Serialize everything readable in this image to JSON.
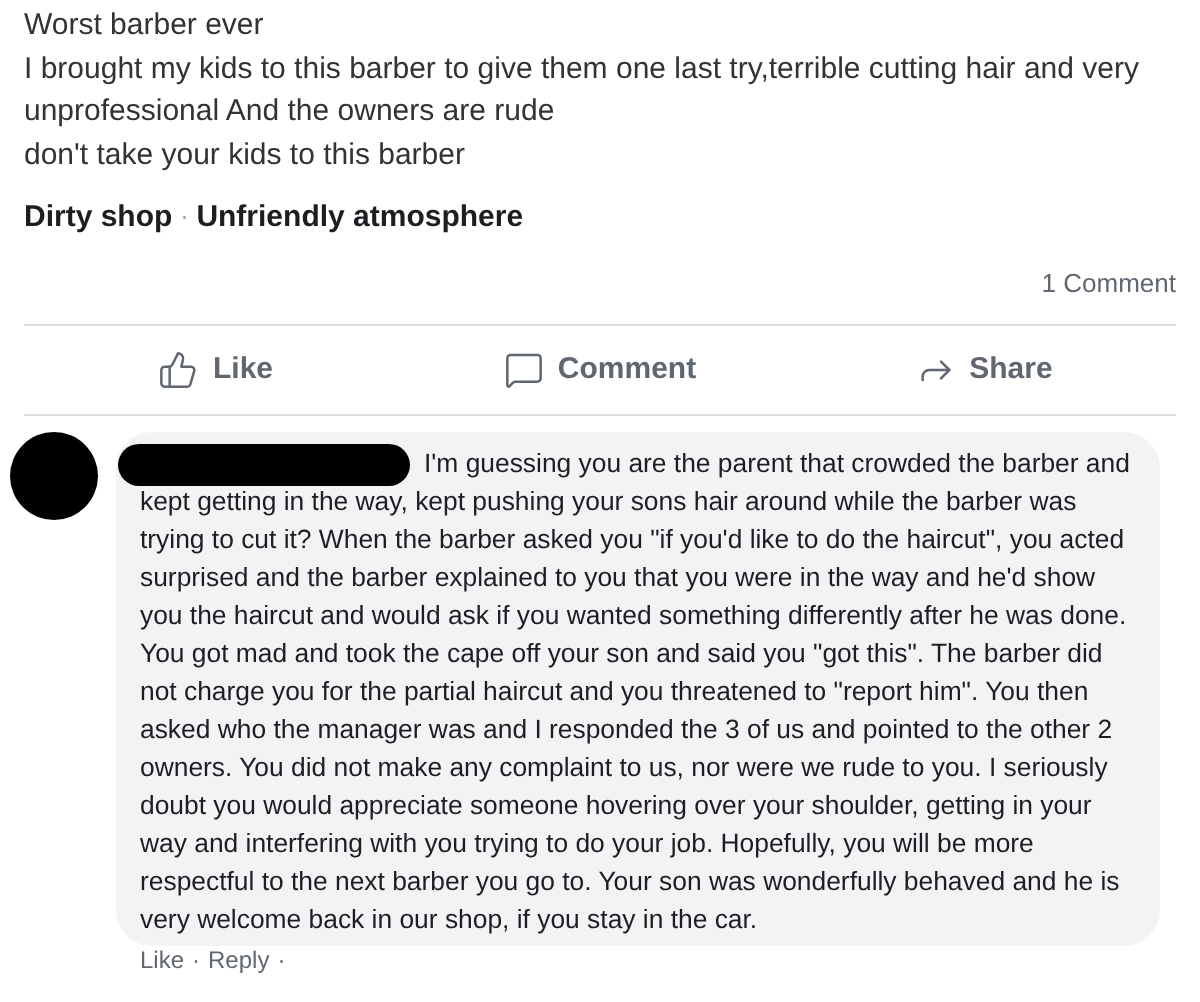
{
  "post": {
    "title": "Worst barber ever",
    "body": [
      "I brought my kids to this barber to give them one last try,terrible cutting hair and very unprofessional And the owners are rude",
      "don't take your kids to this barber"
    ],
    "tags": [
      "Dirty shop",
      "Unfriendly atmosphere"
    ],
    "tag_separator": "·",
    "comment_count": "1 Comment"
  },
  "actions": [
    {
      "kind": "like",
      "label": "Like"
    },
    {
      "kind": "comment",
      "label": "Comment"
    },
    {
      "kind": "share",
      "label": "Share"
    }
  ],
  "comment": {
    "author_redacted": true,
    "text": "I'm guessing you are the parent that crowded the barber and kept getting in the way, kept pushing your sons hair around while the barber was trying to cut it? When the barber asked you \"if you'd like to do the haircut\", you acted surprised and the barber explained to you that you were in the way and he'd show you the haircut and would ask if you wanted something differently after he was done. You got mad and took the cape off your son and said you \"got this\". The barber did not charge you for the partial haircut and you threatened to \"report him\". You then asked who the manager was and I responded the 3 of us and pointed to the other 2 owners. You did not make any complaint to us, nor were we rude to you. I seriously doubt you would appreciate someone hovering over your shoulder, getting in your way and interfering with you trying to do your job. Hopefully, you will be more respectful to the next barber you go to. Your son was wonderfully behaved and he is very welcome back in our shop, if you stay in the car.",
    "links": [
      "Like",
      "Reply"
    ],
    "link_separator": "·"
  }
}
